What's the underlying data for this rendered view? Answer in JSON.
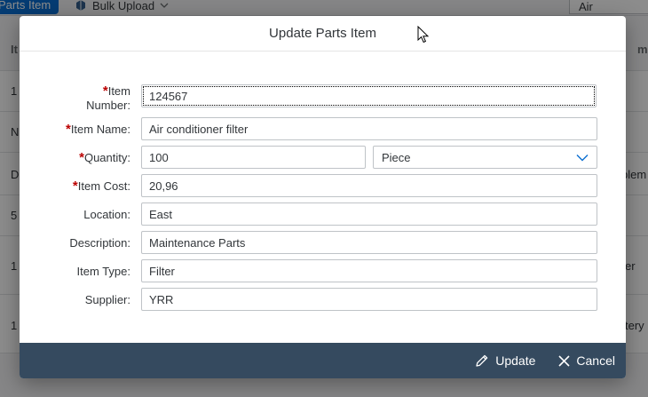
{
  "background": {
    "toolbar": {
      "parts_item_button": "Parts Item",
      "bulk_upload_button": "Bulk Upload",
      "search_value": "Air"
    },
    "table": {
      "header_col1": "It",
      "header_col2": "m Ty",
      "rows": [
        {
          "col1": "1",
          "col2": ""
        },
        {
          "col1": "N",
          "col2": ""
        },
        {
          "col1": "D",
          "col2": "plem"
        },
        {
          "col1": "5",
          "col2": ""
        },
        {
          "col1": "1",
          "col2": "er"
        },
        {
          "col1": "1",
          "col2": "tery"
        }
      ]
    }
  },
  "dialog": {
    "title": "Update Parts Item",
    "fields": {
      "item_number": {
        "label_line1": "Item",
        "label_line2": "Number:",
        "value": "124567",
        "required": true
      },
      "item_name": {
        "label": "Item Name:",
        "value": "Air conditioner filter",
        "required": true
      },
      "quantity": {
        "label": "Quantity:",
        "value": "100",
        "unit": "Piece",
        "required": true
      },
      "item_cost": {
        "label": "Item Cost:",
        "value": "20,96",
        "required": true
      },
      "location": {
        "label": "Location:",
        "value": "East"
      },
      "description": {
        "label": "Description:",
        "value": "Maintenance Parts"
      },
      "item_type": {
        "label": "Item Type:",
        "value": "Filter"
      },
      "supplier": {
        "label": "Supplier:",
        "value": "YRR"
      }
    },
    "required_marker": "*",
    "footer": {
      "update_label": "Update",
      "cancel_label": "Cancel"
    }
  },
  "colors": {
    "footer_bg": "#354a5f",
    "required": "#bb0000",
    "accent": "#0a6ed1"
  }
}
